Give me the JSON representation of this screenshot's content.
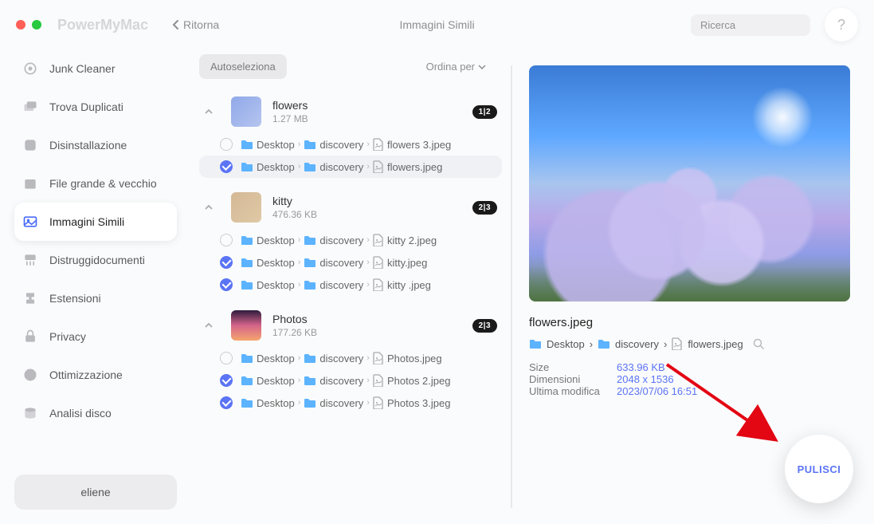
{
  "app_name": "PowerMyMac",
  "back_label": "Ritorna",
  "page_title": "Immagini Simili",
  "search_placeholder": "Ricerca",
  "help_symbol": "?",
  "sidebar": {
    "items": [
      {
        "label": "Junk Cleaner"
      },
      {
        "label": "Trova Duplicati"
      },
      {
        "label": "Disinstallazione"
      },
      {
        "label": "File grande & vecchio"
      },
      {
        "label": "Immagini Simili"
      },
      {
        "label": "Distruggidocumenti"
      },
      {
        "label": "Estensioni"
      },
      {
        "label": "Privacy"
      },
      {
        "label": "Ottimizzazione"
      },
      {
        "label": "Analisi disco"
      }
    ],
    "user": "eliene"
  },
  "list": {
    "autoselect_label": "Autoseleziona",
    "sort_label": "Ordina per",
    "groups": [
      {
        "name": "flowers",
        "size": "1.27 MB",
        "badge": "1|2",
        "files": [
          {
            "checked": false,
            "selected": false,
            "crumbs": [
              "Desktop",
              "discovery"
            ],
            "filename": "flowers 3.jpeg"
          },
          {
            "checked": true,
            "selected": true,
            "crumbs": [
              "Desktop",
              "discovery"
            ],
            "filename": "flowers.jpeg"
          }
        ]
      },
      {
        "name": "kitty",
        "size": "476.36 KB",
        "badge": "2|3",
        "files": [
          {
            "checked": false,
            "selected": false,
            "crumbs": [
              "Desktop",
              "discovery"
            ],
            "filename": "kitty 2.jpeg"
          },
          {
            "checked": true,
            "selected": false,
            "crumbs": [
              "Desktop",
              "discovery"
            ],
            "filename": "kitty.jpeg"
          },
          {
            "checked": true,
            "selected": false,
            "crumbs": [
              "Desktop",
              "discovery"
            ],
            "filename": "kitty .jpeg"
          }
        ]
      },
      {
        "name": "Photos",
        "size": "177.26 KB",
        "badge": "2|3",
        "files": [
          {
            "checked": false,
            "selected": false,
            "crumbs": [
              "Desktop",
              "discovery"
            ],
            "filename": "Photos.jpeg"
          },
          {
            "checked": true,
            "selected": false,
            "crumbs": [
              "Desktop",
              "discovery"
            ],
            "filename": "Photos 2.jpeg"
          },
          {
            "checked": true,
            "selected": false,
            "crumbs": [
              "Desktop",
              "discovery"
            ],
            "filename": "Photos 3.jpeg"
          }
        ]
      }
    ]
  },
  "preview": {
    "filename": "flowers.jpeg",
    "path": [
      "Desktop",
      "discovery",
      "flowers.jpeg"
    ],
    "meta": [
      {
        "label": "Size",
        "value": "633.96 KB"
      },
      {
        "label": "Dimensioni",
        "value": "2048 x 1536"
      },
      {
        "label": "Ultima modifica",
        "value": "2023/07/06 16:51"
      }
    ]
  },
  "clean_label": "PULISCI",
  "crumb_sep": "›"
}
